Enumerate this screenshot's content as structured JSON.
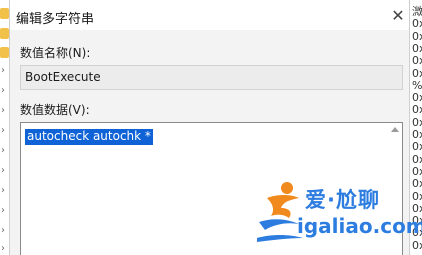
{
  "dialog": {
    "title": "编辑多字符串",
    "close_glyph": "✕",
    "value_name_label": "数值名称(N):",
    "value_name": "BootExecute",
    "value_data_label": "数值数据(V):",
    "value_data": "autocheck autochk *"
  },
  "background": {
    "right_fragments": [
      "溦",
      "0x",
      "0x",
      "0x",
      "0x",
      "0x",
      "%",
      "0x",
      "0x",
      "0x",
      "0x",
      "0x",
      "0x",
      "0x",
      "0x",
      "0x",
      "0x",
      "0x",
      "0x",
      "0x"
    ]
  },
  "watermark": {
    "title": "爱·尬聊",
    "url": "igaliao.com",
    "colors": {
      "blue": "#2d7de0",
      "orange": "#f08a1c"
    }
  },
  "colors": {
    "selection": "#0f63d6",
    "dialog_bg": "#f3f3f3"
  }
}
